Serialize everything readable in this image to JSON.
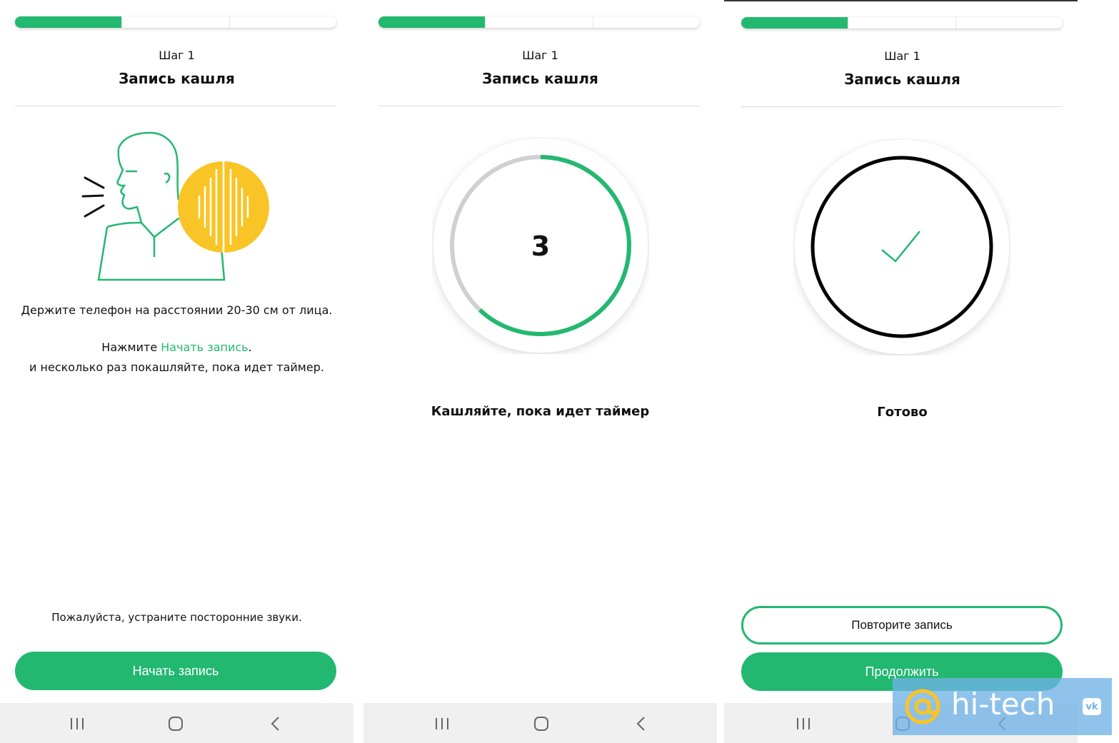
{
  "colors": {
    "accent": "#23b870",
    "sound_circle": "#f9c425",
    "timer_track": "#d0d0d0",
    "watermark_bg": "#70b2e7"
  },
  "progress": {
    "segments": 3,
    "completed": 1
  },
  "screens": [
    {
      "step_label": "Шаг 1",
      "title": "Запись кашля",
      "illustration": "person-coughing-with-sound-wave-illustration",
      "instructions": {
        "line1": "Держите телефон на расстоянии 20-30 см от лица.",
        "press_prefix": "Нажмите ",
        "press_link": "Начать запись",
        "press_suffix": ".",
        "line3": "и несколько раз покашляйте, пока идет таймер."
      },
      "hint": "Пожалуйста, устраните посторонние звуки.",
      "primary_button": "Начать запись"
    },
    {
      "step_label": "Шаг 1",
      "title": "Запись кашля",
      "timer": {
        "value": "3",
        "progress": 0.62
      },
      "caption": "Кашляйте, пока идет таймер"
    },
    {
      "step_label": "Шаг 1",
      "title": "Запись кашля",
      "done_icon": "check-icon",
      "caption": "Готово",
      "secondary_button": "Повторите запись",
      "primary_button": "Продолжить"
    }
  ],
  "navbar": {
    "icons": [
      "recent-apps-icon",
      "home-icon",
      "back-icon"
    ]
  },
  "watermark": {
    "brand": "hi-tech",
    "icon": "at-sign-icon",
    "badge": "vk"
  }
}
